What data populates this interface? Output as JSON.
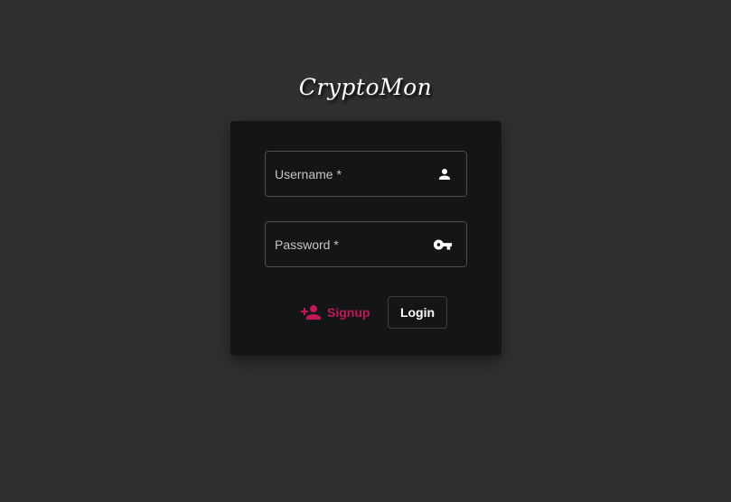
{
  "app": {
    "title": "CryptoMon"
  },
  "login_form": {
    "username": {
      "placeholder": "Username *",
      "value": "",
      "icon": "person-icon"
    },
    "password": {
      "placeholder": "Password *",
      "value": "",
      "icon": "key-icon"
    },
    "signup_label": "Signup",
    "signup_icon": "person-add-icon",
    "login_label": "Login"
  },
  "colors": {
    "background": "#303030",
    "card": "#141517",
    "accent": "#c2185b",
    "field_border": "#4b4c4e",
    "text": "#ffffff"
  }
}
